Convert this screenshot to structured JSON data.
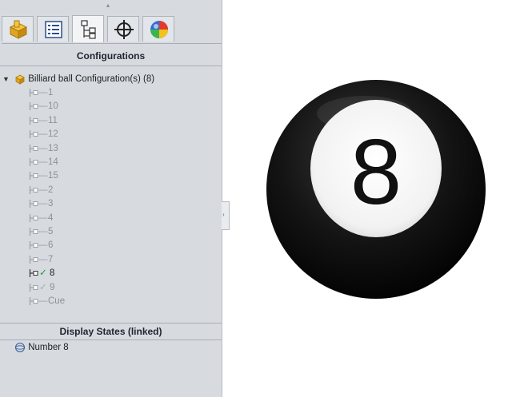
{
  "panel": {
    "tabs": [
      {
        "icon": "part-icon"
      },
      {
        "icon": "property-manager-icon"
      },
      {
        "icon": "configuration-manager-icon",
        "active": true
      },
      {
        "icon": "dimxpert-icon"
      },
      {
        "icon": "display-manager-icon"
      }
    ],
    "configurations_header": "Configurations",
    "root_label": "Billiard ball Configuration(s)  (8)",
    "items": [
      {
        "label": "1",
        "state": "none"
      },
      {
        "label": "10",
        "state": "none"
      },
      {
        "label": "11",
        "state": "none"
      },
      {
        "label": "12",
        "state": "none"
      },
      {
        "label": "13",
        "state": "none"
      },
      {
        "label": "14",
        "state": "none"
      },
      {
        "label": "15",
        "state": "none"
      },
      {
        "label": "2",
        "state": "none"
      },
      {
        "label": "3",
        "state": "none"
      },
      {
        "label": "4",
        "state": "none"
      },
      {
        "label": "5",
        "state": "none"
      },
      {
        "label": "6",
        "state": "none"
      },
      {
        "label": "7",
        "state": "none"
      },
      {
        "label": "8",
        "state": "active"
      },
      {
        "label": "9",
        "state": "linked"
      },
      {
        "label": "Cue",
        "state": "none"
      }
    ],
    "display_states_header": "Display States (linked)",
    "display_state": "Number 8"
  },
  "viewport": {
    "ball_number": "8",
    "colors": {
      "ball": "#0d0d0d",
      "circle": "#ffffff",
      "number": "#111111"
    }
  }
}
